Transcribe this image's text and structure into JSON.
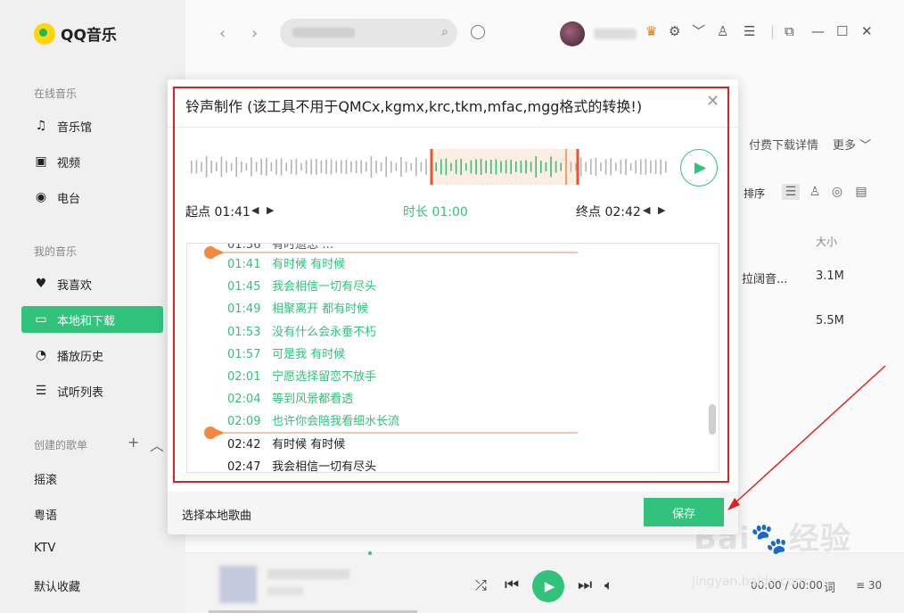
{
  "app": {
    "name": "QQ音乐"
  },
  "sidebar": {
    "section_online": "在线音乐",
    "online_items": [
      {
        "label": "音乐馆",
        "icon": "music-note-icon"
      },
      {
        "label": "视频",
        "icon": "video-icon"
      },
      {
        "label": "电台",
        "icon": "radio-icon"
      }
    ],
    "section_mine": "我的音乐",
    "mine_items": [
      {
        "label": "我喜欢",
        "icon": "heart-icon"
      },
      {
        "label": "本地和下载",
        "icon": "computer-icon",
        "active": true
      },
      {
        "label": "播放历史",
        "icon": "clock-icon"
      },
      {
        "label": "试听列表",
        "icon": "playlist-icon"
      }
    ],
    "section_created": "创建的歌单",
    "playlists": [
      "摇滚",
      "粤语",
      "KTV",
      "默认收藏"
    ]
  },
  "main": {
    "paid_download_detail": "付费下载详情",
    "more": "更多",
    "sort_label": "排序",
    "size_header": "大小",
    "rows": [
      {
        "album": "拉阔音...",
        "size": "3.1M"
      },
      {
        "album": "",
        "size": "5.5M"
      }
    ]
  },
  "dialog": {
    "title": "铃声制作 (该工具不用于QMCx,kgmx,krc,tkm,mfac,mgg格式的转换!)",
    "start_label": "起点 01:41",
    "duration_label": "时长 01:00",
    "end_label": "终点  02:42",
    "lyrics": [
      {
        "time": "01:41",
        "text": "有时候 有时候",
        "selected": true
      },
      {
        "time": "01:45",
        "text": "我会相信一切有尽头",
        "selected": true
      },
      {
        "time": "01:49",
        "text": "相聚离开 都有时候",
        "selected": true
      },
      {
        "time": "01:53",
        "text": "没有什么会永垂不朽",
        "selected": true
      },
      {
        "time": "01:57",
        "text": "可是我 有时候",
        "selected": true
      },
      {
        "time": "02:01",
        "text": "宁愿选择留恋不放手",
        "selected": true
      },
      {
        "time": "02:04",
        "text": "等到风景都看透",
        "selected": true
      },
      {
        "time": "02:09",
        "text": "也许你会陪我看细水长流",
        "selected": true
      },
      {
        "time": "02:42",
        "text": "有时候 有时候",
        "selected": false
      },
      {
        "time": "02:47",
        "text": "我会相信一切有尽头",
        "selected": false
      }
    ],
    "choose_local": "选择本地歌曲",
    "save_label": "保存"
  },
  "player": {
    "time": "00:00 / 00:00",
    "lyric_button": "词",
    "playlist_count": "30"
  },
  "watermark": {
    "brand": "Baidu经验",
    "url": "jingyan.baidu.com"
  },
  "colors": {
    "accent": "#31c27c",
    "annotation": "#e02020",
    "selection_edge": "#e8552b"
  }
}
